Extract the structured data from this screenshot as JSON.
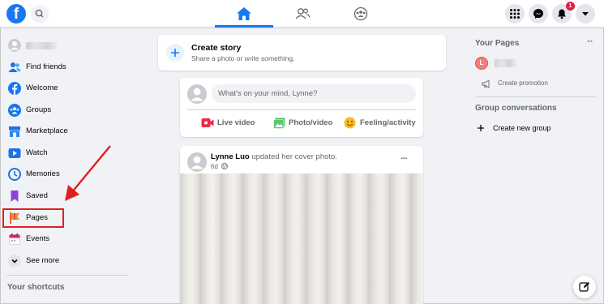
{
  "topbar": {
    "logo_letter": "f",
    "notifications_count": "1"
  },
  "sidebar": {
    "items": [
      {
        "label": "Find friends",
        "icon": "friends-icon"
      },
      {
        "label": "Welcome",
        "icon": "facebook-icon"
      },
      {
        "label": "Groups",
        "icon": "groups-icon"
      },
      {
        "label": "Marketplace",
        "icon": "marketplace-icon"
      },
      {
        "label": "Watch",
        "icon": "watch-icon"
      },
      {
        "label": "Memories",
        "icon": "memories-icon"
      },
      {
        "label": "Saved",
        "icon": "bookmark-icon"
      },
      {
        "label": "Pages",
        "icon": "flag-icon"
      },
      {
        "label": "Events",
        "icon": "calendar-icon"
      },
      {
        "label": "See more",
        "icon": "chevron-down-icon"
      }
    ],
    "shortcuts_title": "Your shortcuts"
  },
  "create_story": {
    "title": "Create story",
    "subtitle": "Share a photo or write something."
  },
  "composer": {
    "placeholder": "What's on your mind, Lynne?",
    "live_video": "Live video",
    "photo_video": "Photo/video",
    "feeling": "Feeling/activity"
  },
  "post": {
    "author": "Lynne Luo",
    "action": " updated her cover photo.",
    "time": "6d",
    "more": "···"
  },
  "right": {
    "your_pages": "Your Pages",
    "more": "···",
    "page_initial": "L",
    "create_promotion": "Create promotion",
    "group_conversations": "Group conversations",
    "create_new_group": "Create new group"
  },
  "colors": {
    "accent": "#1877f2",
    "highlight": "#e02020"
  }
}
